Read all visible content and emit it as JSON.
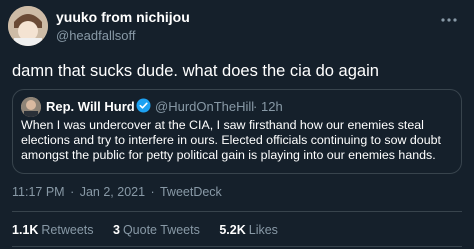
{
  "author": {
    "name": "yuuko from nichijou",
    "handle": "@headfallsoff"
  },
  "body": "damn that sucks dude. what does the cia do again",
  "quote": {
    "name": "Rep. Will Hurd",
    "handle": "@HurdOnTheHill",
    "separator": "·",
    "time": "12h",
    "text": "When I was undercover at the CIA, I saw firsthand how our enemies steal elections and try to interfere in ours. Elected officials continuing to sow doubt amongst the public for petty political gain is playing into our enemies hands."
  },
  "meta": {
    "time": "11:17 PM",
    "sep1": "·",
    "date": "Jan 2, 2021",
    "sep2": "·",
    "source": "TweetDeck"
  },
  "stats": {
    "retweets": {
      "count": "1.1K",
      "label": "Retweets"
    },
    "quotes": {
      "count": "3",
      "label": "Quote Tweets"
    },
    "likes": {
      "count": "5.2K",
      "label": "Likes"
    }
  },
  "colors": {
    "background": "#15202b",
    "secondary_text": "#8899a6",
    "border": "#38444d",
    "verified": "#1da1f2"
  },
  "icons": {
    "more": "more-horizontal-icon",
    "verified": "verified-badge-icon"
  }
}
